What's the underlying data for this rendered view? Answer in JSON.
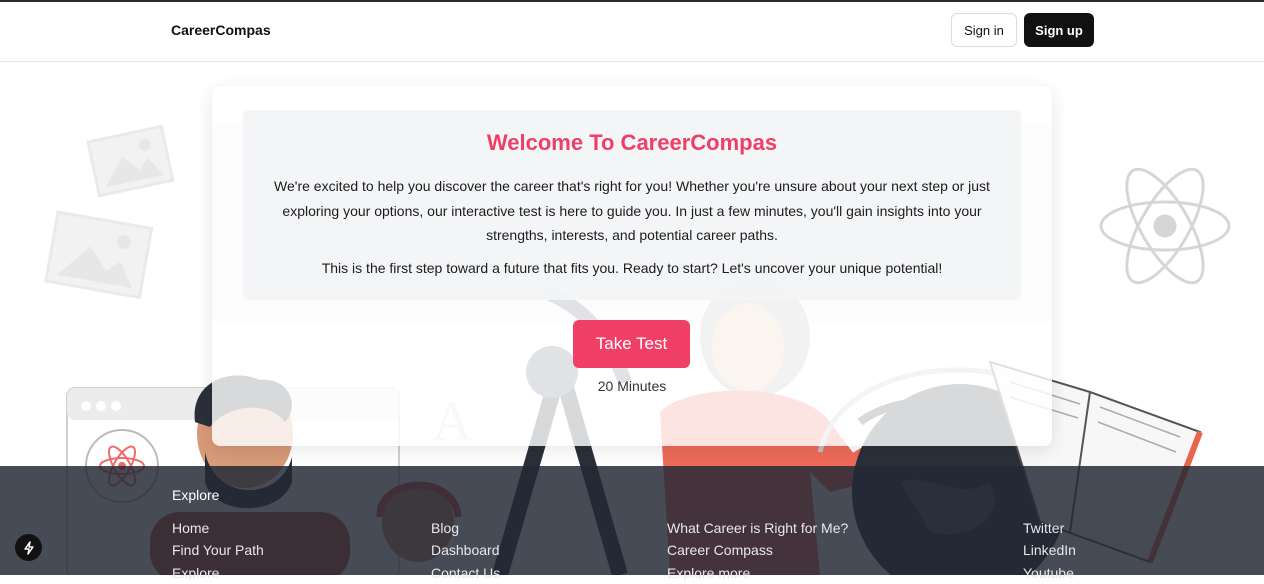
{
  "header": {
    "brand": "CareerCompas",
    "signin_label": "Sign in",
    "signup_label": "Sign up"
  },
  "card": {
    "title": "Welcome To CareerCompas",
    "paragraph1": "We're excited to help you discover the career that's right for you! Whether you're unsure about your next step or just exploring your options, our interactive test is here to guide you. In just a few minutes, you'll gain insights into your strengths, interests, and potential career paths.",
    "paragraph2": "This is the first step toward a future that fits you. Ready to start? Let's uncover your unique potential!",
    "button_label": "Take Test",
    "duration": "20 Minutes"
  },
  "footer": {
    "title": "Explore",
    "columns": [
      [
        "Home",
        "Find Your Path",
        "Explore"
      ],
      [
        "Blog",
        "Dashboard",
        "Contact Us"
      ],
      [
        "What Career is Right for Me?",
        "Career Compass",
        "Explore more"
      ],
      [
        "Twitter",
        "LinkedIn",
        "Youtube"
      ]
    ]
  },
  "colors": {
    "accent": "#f03f66",
    "footer_bg": "#222934",
    "dark_button": "#111111"
  },
  "icons": [
    "image-placeholder-icon",
    "atom-icon",
    "lightning-bolt-icon"
  ]
}
